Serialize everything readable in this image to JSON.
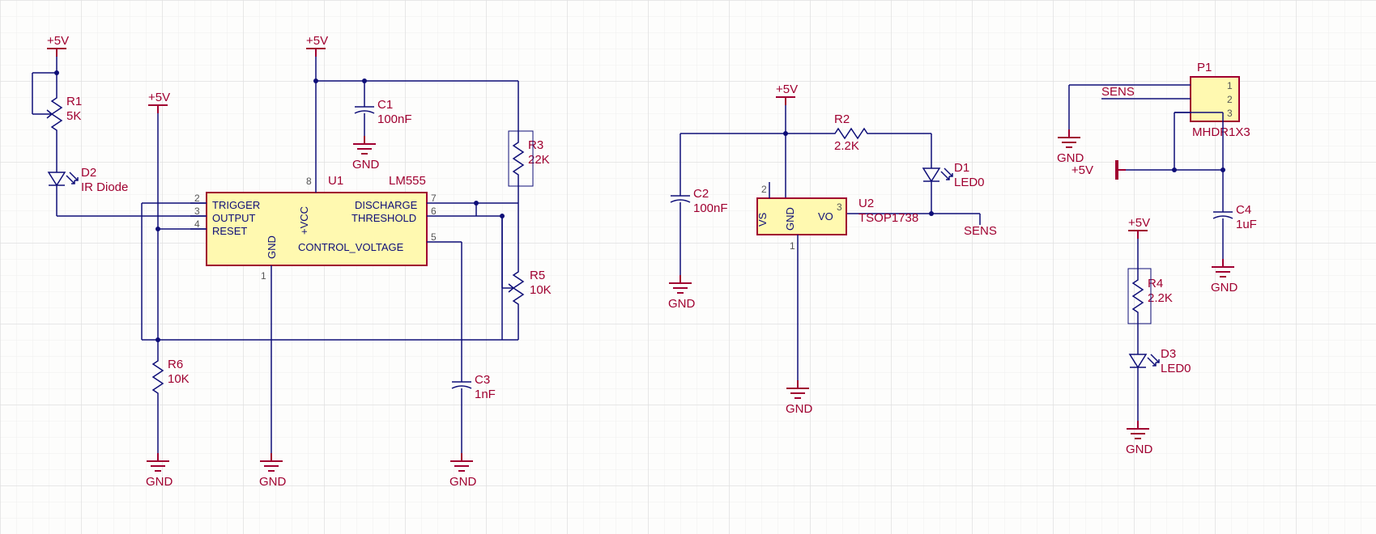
{
  "power": {
    "p5v": "+5V"
  },
  "ground_label": "GND",
  "netlabels": {
    "sens": "SENS"
  },
  "U1": {
    "ref": "U1",
    "value": "LM555",
    "pins": {
      "trigger": {
        "no": "2",
        "name": "TRIGGER"
      },
      "output": {
        "no": "3",
        "name": "OUTPUT"
      },
      "reset": {
        "no": "4",
        "name": "RESET"
      },
      "control_voltage": {
        "no": "5",
        "name": "CONTROL_VOLTAGE"
      },
      "threshold": {
        "no": "6",
        "name": "THRESHOLD"
      },
      "discharge": {
        "no": "7",
        "name": "DISCHARGE"
      },
      "vcc": {
        "no": "8",
        "name": "+VCC"
      },
      "gnd": {
        "no": "1",
        "name": "GND"
      }
    }
  },
  "U2": {
    "ref": "U2",
    "value": "TSOP1738",
    "pins": {
      "vs": {
        "no": "2",
        "name": "VS"
      },
      "gnd": {
        "no": "1",
        "name": "GND"
      },
      "vo": {
        "no": "3",
        "name": "VO"
      }
    }
  },
  "P1": {
    "ref": "P1",
    "value": "MHDR1X3",
    "pins": {
      "p1": "1",
      "p2": "2",
      "p3": "3"
    }
  },
  "R1": {
    "ref": "R1",
    "value": "5K"
  },
  "R2": {
    "ref": "R2",
    "value": "2.2K"
  },
  "R3": {
    "ref": "R3",
    "value": "22K"
  },
  "R4": {
    "ref": "R4",
    "value": "2.2K"
  },
  "R5": {
    "ref": "R5",
    "value": "10K"
  },
  "R6": {
    "ref": "R6",
    "value": "10K"
  },
  "C1": {
    "ref": "C1",
    "value": "100nF"
  },
  "C2": {
    "ref": "C2",
    "value": "100nF"
  },
  "C3": {
    "ref": "C3",
    "value": "1nF"
  },
  "C4": {
    "ref": "C4",
    "value": "1uF"
  },
  "D1": {
    "ref": "D1",
    "value": "LED0"
  },
  "D2": {
    "ref": "D2",
    "value": "IR Diode"
  },
  "D3": {
    "ref": "D3",
    "value": "LED0"
  }
}
